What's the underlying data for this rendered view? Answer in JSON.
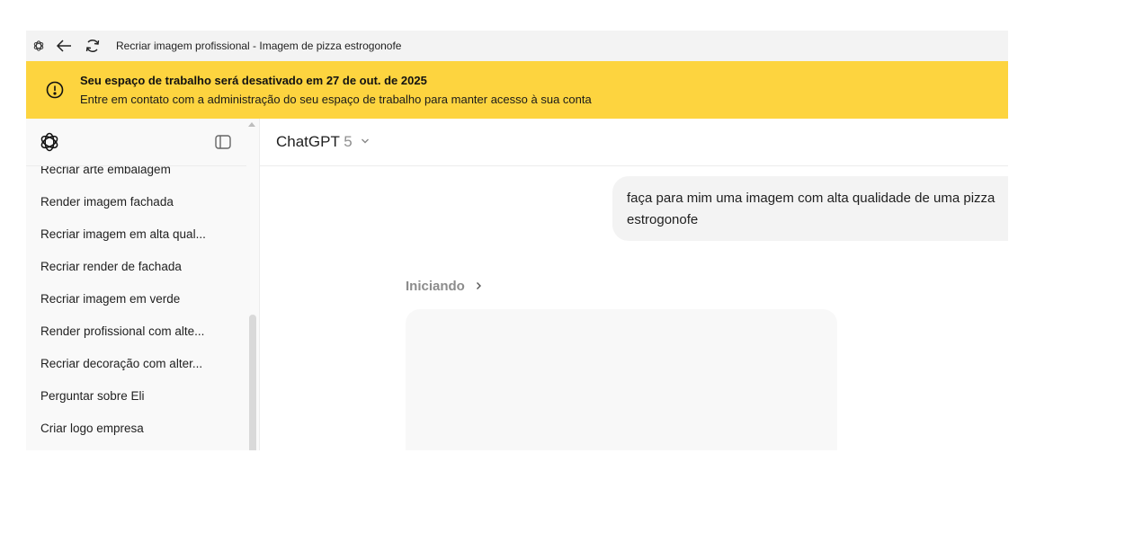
{
  "titlebar": {
    "title": "Recriar imagem profissional - Imagem de pizza estrogonofe",
    "icons": [
      "chatgpt-logo-icon",
      "back-arrow-icon",
      "refresh-icon"
    ]
  },
  "banner": {
    "title": "Seu espaço de trabalho será desativado em 27 de out. de 2025",
    "text": "Entre em contato com a administração do seu espaço de trabalho para manter acesso à sua conta",
    "icon": "alert-circle-icon",
    "color": "#fdd43f"
  },
  "sidebar": {
    "items": [
      {
        "label": "Recriar arte embalagem"
      },
      {
        "label": "Render imagem fachada"
      },
      {
        "label": "Recriar imagem em alta qual..."
      },
      {
        "label": "Recriar render de fachada"
      },
      {
        "label": "Recriar imagem em verde"
      },
      {
        "label": "Render profissional com alte..."
      },
      {
        "label": "Recriar decoração com alter..."
      },
      {
        "label": "Perguntar sobre Eli"
      },
      {
        "label": "Criar logo empresa"
      }
    ]
  },
  "main": {
    "model_name": "ChatGPT",
    "model_version": "5",
    "user_message": "faça para mim uma imagem com alta qualidade de uma pizza\nestrogonofe",
    "status": "Iniciando"
  }
}
